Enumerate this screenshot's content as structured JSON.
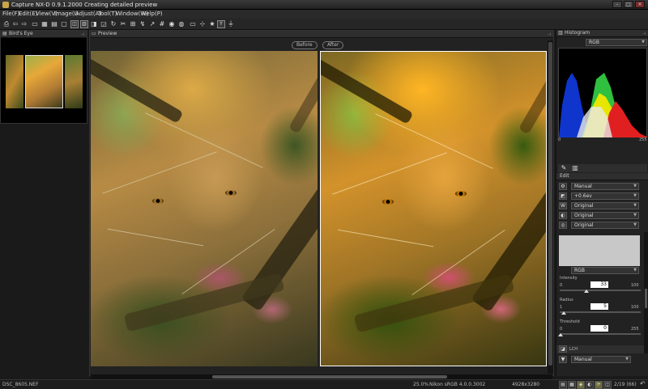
{
  "window": {
    "title": "Capture NX-D 0.9.1.2000    Creating detailed preview"
  },
  "menu": [
    "File(F)",
    "Edit(E)",
    "View(V)",
    "Image(I)",
    "Adjust(A)",
    "Tool(T)",
    "Window(W)",
    "Help(P)"
  ],
  "toolbar_icons": [
    "print-icon",
    "back-icon",
    "forward-icon",
    "folder-icon",
    "grid-view-icon",
    "filmstrip-icon",
    "single-view-icon",
    "compare-icon",
    "fit-icon",
    "zoom-icon",
    "rotate-left-icon",
    "rotate-right-icon",
    "crop-icon",
    "straighten-icon",
    "redeye-icon",
    "retouch-icon",
    "color-picker-icon",
    "highlight-icon",
    "monitor-icon",
    "settings-icon",
    "star-icon",
    "label-icon",
    "filter-icon"
  ],
  "birds_eye": {
    "title": "Bird's Eye"
  },
  "preview": {
    "title": "Preview",
    "before_label": "Before",
    "after_label": "After"
  },
  "histogram": {
    "title": "Histogram",
    "channel": "RGB",
    "axis_min": "0",
    "axis_max": "255"
  },
  "edit": {
    "title": "Edit",
    "rows": [
      "Manual",
      "+0.6ev",
      "Original",
      "Original",
      "Original"
    ],
    "unsharp_channel": "RGB",
    "intensity": {
      "label": "Intensity",
      "min": "0",
      "max": "100",
      "value": "33"
    },
    "radius": {
      "label": "Radius",
      "min": "1",
      "max": "100",
      "value": "5"
    },
    "threshold": {
      "label": "Threshold",
      "min": "0",
      "max": "255",
      "value": "0"
    },
    "lch_label": "LCH",
    "lch_mode": "Manual"
  },
  "status": {
    "filename": "DSC_8605.NEF",
    "zoom": "25.0%",
    "profile": "Nikon sRGB 4.0.0.3002",
    "dimensions": "4928x3280",
    "index": "2/19 (66)"
  }
}
